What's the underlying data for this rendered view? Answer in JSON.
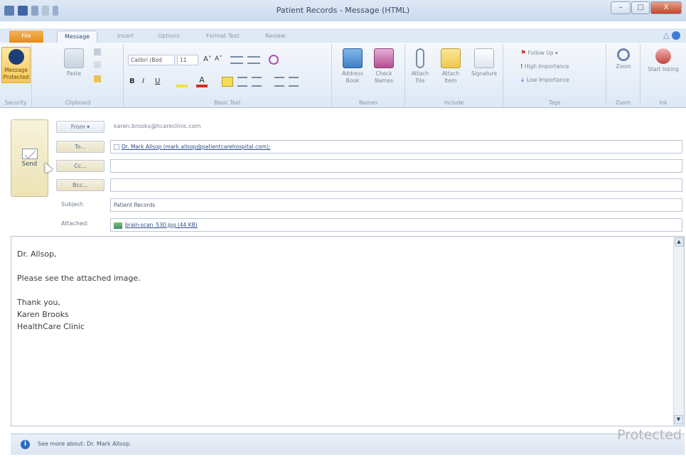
{
  "window": {
    "title": "Patient Records - Message (HTML)",
    "controls": [
      "–",
      "□",
      "X"
    ]
  },
  "tabs": [
    "File",
    "Message",
    "Insert",
    "Options",
    "Format Text",
    "Review"
  ],
  "ribbon": {
    "security": {
      "button": "Message Protected",
      "group": "Security"
    },
    "clipboard": {
      "paste": "Paste",
      "group": "Clipboard"
    },
    "basic_text": {
      "font": "Calibri (Bod",
      "size": "11",
      "grow": "A˄",
      "shrink": "A˅",
      "bold": "B",
      "italic": "I",
      "underline": "U",
      "group": "Basic Text"
    },
    "names": {
      "address_book": "Address Book",
      "check_names": "Check Names",
      "group": "Names"
    },
    "include": {
      "attach_file": "Attach File",
      "attach_item": "Attach Item",
      "signature": "Signature",
      "group": "Include"
    },
    "tags": {
      "follow_up": "Follow Up",
      "high": "High Importance",
      "low": "Low Importance",
      "group": "Tags"
    },
    "zoom": {
      "button": "Zoom",
      "group": "Zoom"
    },
    "ink": {
      "button": "Start Inking",
      "group": "Ink"
    }
  },
  "header": {
    "send": "Send",
    "from_button": "From ▾",
    "from_value": "karen.brooks@hcareclinic.com",
    "to_button": "To...",
    "to_value": "Dr. Mark Allsop (mark.allsop@patientcarehospital.com);",
    "cc_button": "Cc...",
    "bcc_button": "Bcc...",
    "subject_label": "Subject:",
    "subject_value": "Patient Records",
    "attached_label": "Attached:",
    "attached_value": "brain-scan_530.jpg (44 KB)"
  },
  "body": {
    "lines": [
      "Dr. Allsop,",
      "",
      "Please see the attached image.",
      "",
      "Thank you,",
      "Karen Brooks",
      "HealthCare Clinic"
    ]
  },
  "status": {
    "text": "See more about: Dr. Mark Allsop.",
    "watermark": "Protected"
  },
  "colors": {
    "file_tab": "#e48d19",
    "accent": "#2b6bc4",
    "follow_up_flag": "#c0392b",
    "high_importance": "#d32f2f",
    "low_importance": "#2e6fd0"
  }
}
